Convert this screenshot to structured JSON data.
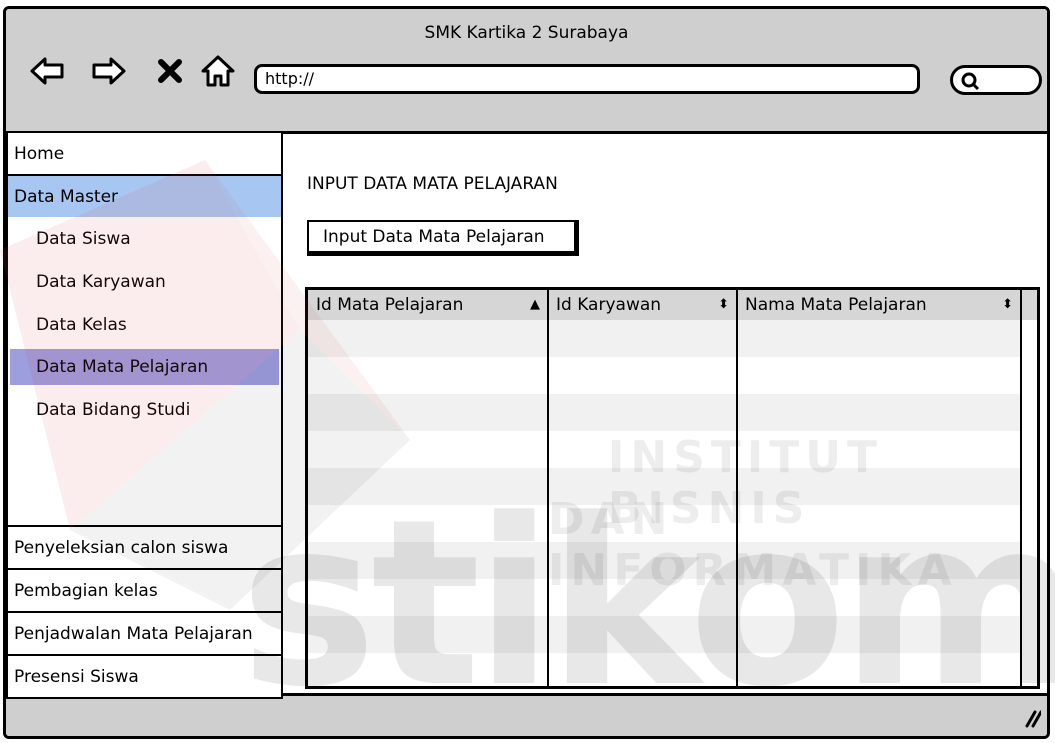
{
  "window": {
    "title": "SMK Kartika 2 Surabaya"
  },
  "nav": {
    "url": "http://"
  },
  "sidebar": {
    "top_items": [
      {
        "label": "Home"
      },
      {
        "label": "Data Master"
      }
    ],
    "sub_items": [
      {
        "label": "Data Siswa"
      },
      {
        "label": "Data Karyawan"
      },
      {
        "label": "Data Kelas"
      },
      {
        "label": "Data Mata Pelajaran"
      },
      {
        "label": "Data Bidang Studi"
      }
    ],
    "bottom_items": [
      {
        "label": "Penyeleksian calon siswa"
      },
      {
        "label": "Pembagian kelas"
      },
      {
        "label": "Penjadwalan Mata Pelajaran"
      },
      {
        "label": "Presensi Siswa"
      }
    ]
  },
  "main": {
    "heading": "INPUT DATA MATA PELAJARAN",
    "button_label": "Input Data Mata Pelajaran",
    "table": {
      "columns": [
        {
          "label": "Id Mata Pelajaran",
          "sort": "ascending"
        },
        {
          "label": "Id Karyawan",
          "sort": "sortable"
        },
        {
          "label": "Nama Mata Pelajaran",
          "sort": "sortable"
        }
      ],
      "rows": []
    }
  },
  "watermark": {
    "line1": "INSTITUT BISNIS",
    "line2": "DAN INFORMATIKA",
    "logo_text": "stikom"
  },
  "colors": {
    "chrome": "#cfcfcf",
    "selected_menu": "#a7c7f2",
    "selected_submenu": "#9c9ede",
    "table_header": "#d6d6d6"
  }
}
